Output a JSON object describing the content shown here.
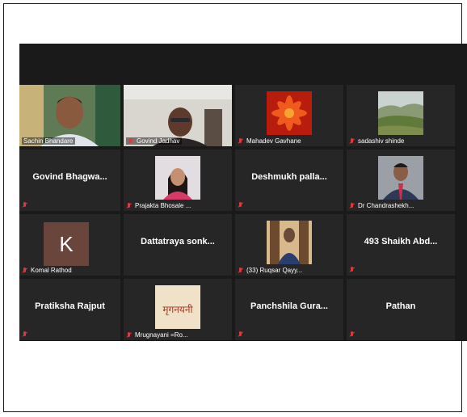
{
  "participants": [
    {
      "name": "Sachin Bhandare",
      "kind": "video"
    },
    {
      "name": "Govind Jadhav",
      "kind": "video"
    },
    {
      "name": "Mahadev Gavhane",
      "kind": "photo",
      "photo": "flower"
    },
    {
      "name": "sadashiv shinde",
      "kind": "photo",
      "photo": "landscape"
    },
    {
      "name": "Govind  Bhagwa...",
      "kind": "name"
    },
    {
      "name": "Prajakta Bhosale ...",
      "kind": "photo",
      "photo": "woman"
    },
    {
      "name": "Deshmukh  palla...",
      "kind": "name"
    },
    {
      "name": "Dr Chandrashekh...",
      "kind": "photo",
      "photo": "man-suit"
    },
    {
      "name": "Komal Rathod",
      "kind": "letter",
      "letter": "K"
    },
    {
      "name": "Dattatraya  sonk...",
      "kind": "name"
    },
    {
      "name": "(33) Ruqsar Qayy...",
      "kind": "photo",
      "photo": "man-door"
    },
    {
      "name": "493  Shaikh  Abd...",
      "kind": "name"
    },
    {
      "name": "Pratiksha Rajput",
      "kind": "name"
    },
    {
      "name": "Mrugnayani =Ro...",
      "kind": "photo",
      "photo": "calligraphy",
      "photo_text": "मृगनयनी"
    },
    {
      "name": "Panchshila  Gura...",
      "kind": "name"
    },
    {
      "name": "Pathan",
      "kind": "name"
    }
  ],
  "colors": {
    "background": "#1a1a1a",
    "tile": "#262626",
    "muted_mic": "#e0383e"
  }
}
